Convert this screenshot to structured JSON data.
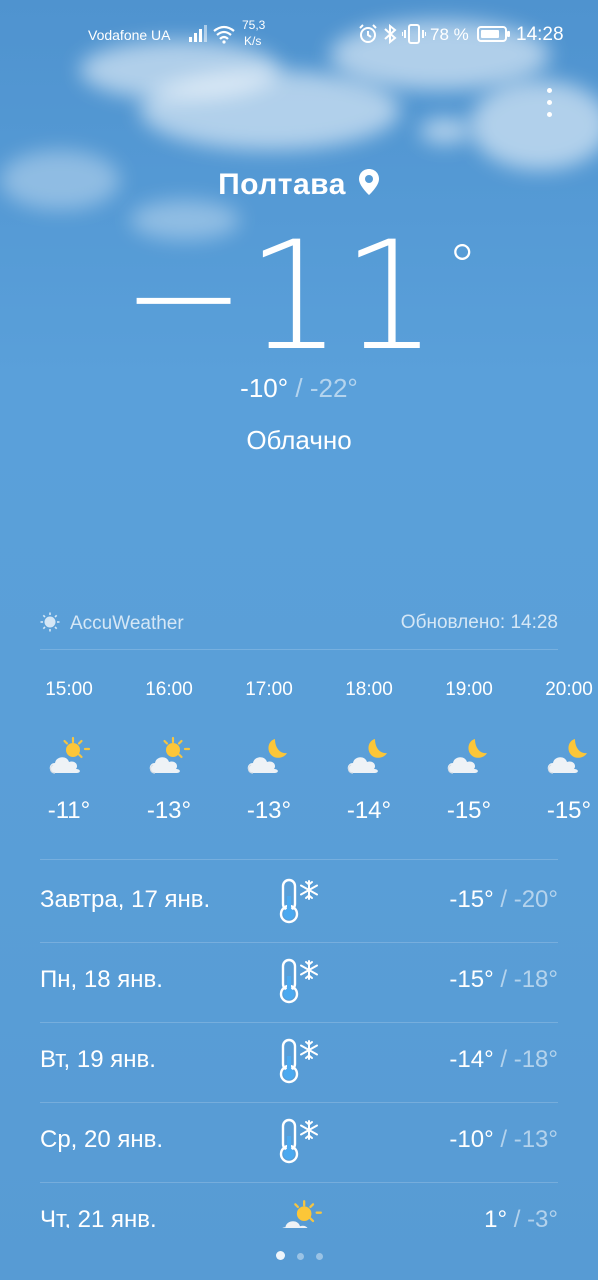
{
  "status_bar": {
    "carrier": "Vodafone UA",
    "net_speed_value": "75,3",
    "net_speed_unit": "K/s",
    "battery_percent": "78 %",
    "time": "14:28",
    "icons": [
      "signal-icon",
      "wifi-icon",
      "alarm-icon",
      "bluetooth-icon",
      "vibrate-icon",
      "battery-icon"
    ]
  },
  "location": {
    "city": "Полтава"
  },
  "current": {
    "temperature": "−11",
    "degree_sign": "°",
    "high": "-10°",
    "separator": " / ",
    "low": "-22°",
    "condition": "Облачно"
  },
  "provider": {
    "name": "AccuWeather",
    "updated": "Обновлено: 14:28"
  },
  "hourly": [
    {
      "time": "15:00",
      "icon": "partly-sunny-icon",
      "temp": "-11°"
    },
    {
      "time": "16:00",
      "icon": "partly-sunny-icon",
      "temp": "-13°"
    },
    {
      "time": "17:00",
      "icon": "cloudy-night-icon",
      "temp": "-13°"
    },
    {
      "time": "18:00",
      "icon": "cloudy-night-icon",
      "temp": "-14°"
    },
    {
      "time": "19:00",
      "icon": "cloudy-night-icon",
      "temp": "-15°"
    },
    {
      "time": "20:00",
      "icon": "cloudy-night-icon",
      "temp": "-15°"
    }
  ],
  "daily": [
    {
      "day": "Завтра, 17 янв.",
      "icon": "frost-thermometer-icon",
      "high": "-15°",
      "low": "-20°"
    },
    {
      "day": "Пн, 18 янв.",
      "icon": "frost-thermometer-icon",
      "high": "-15°",
      "low": "-18°"
    },
    {
      "day": "Вт, 19 янв.",
      "icon": "frost-thermometer-icon",
      "high": "-14°",
      "low": "-18°"
    },
    {
      "day": "Ср, 20 янв.",
      "icon": "frost-thermometer-icon",
      "high": "-10°",
      "low": "-13°"
    },
    {
      "day": "Чт, 21 янв.",
      "icon": "partly-sunny-icon",
      "high": "1°",
      "low": "-3°"
    }
  ],
  "pager": {
    "pages": 3,
    "active": 0
  }
}
